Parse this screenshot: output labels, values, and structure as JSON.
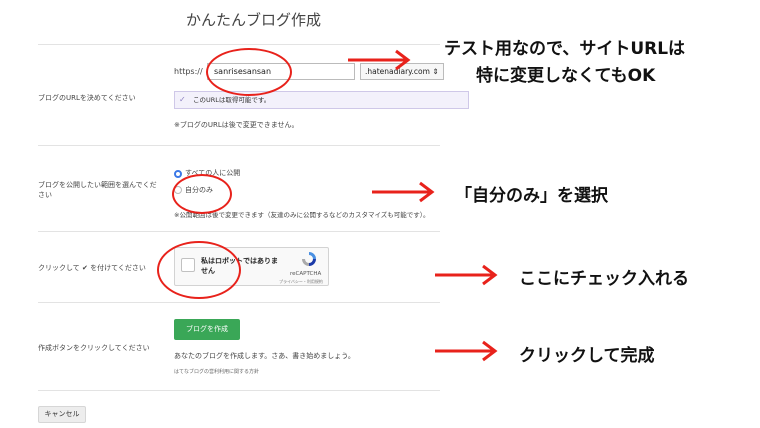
{
  "page_title": "かんたんブログ作成",
  "url_section": {
    "label": "ブログのURLを決めてください",
    "prefix": "https://",
    "subdomain_value": "sanrisesansan",
    "domain_selected": ".hatenadiary.com ⇕",
    "availability_message": "このURLは取得可能です。",
    "note": "※ブログのURLは後で変更できません。"
  },
  "visibility_section": {
    "label": "ブログを公開したい範囲を選んでください",
    "option_all": "すべての人に公開",
    "option_self": "自分のみ",
    "note": "※公開範囲は後で変更できます（友達のみに公開するなどのカスタマイズも可能です）。"
  },
  "captcha_section": {
    "label": "クリックして ✔ を付けてください",
    "checkbox_text": "私はロボットではありません",
    "brand": "reCAPTCHA",
    "links": "プライバシー・利用規約"
  },
  "create_section": {
    "label": "作成ボタンをクリックしてください",
    "button": "ブログを作成",
    "message": "あなたのブログを作成します。さあ、書き始めましょう。",
    "guideline_link": "はてなブログの営利利用に関する方針"
  },
  "cancel_button": "キャンセル",
  "annotations": {
    "url_note_line1": "テスト用なので、サイトURLは",
    "url_note_line2": "特に変更しなくてもOK",
    "visibility_note": "「自分のみ」を選択",
    "captcha_note": "ここにチェック入れる",
    "create_note": "クリックして完成"
  },
  "colors": {
    "annotation_red": "#e8221b",
    "button_green": "#3aa757",
    "radio_blue": "#3b78e7"
  }
}
